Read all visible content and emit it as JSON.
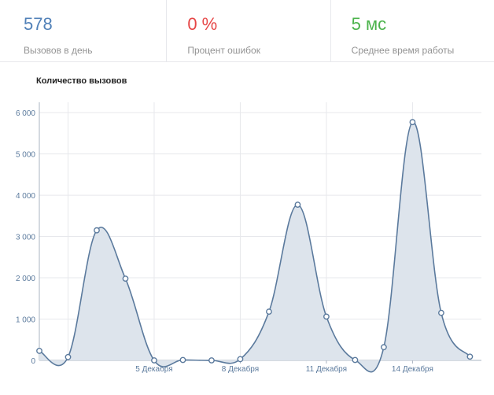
{
  "stats": [
    {
      "value": "578",
      "label": "Вызовов в день",
      "color": "#5181b8"
    },
    {
      "value": "0 %",
      "label": "Процент ошибок",
      "color": "#e64646"
    },
    {
      "value": "5 мс",
      "label": "Среднее время работы",
      "color": "#4bb34b"
    }
  ],
  "chart_data": {
    "type": "area",
    "title": "Количество вызовов",
    "ylim": [
      0,
      6250
    ],
    "yticks": [
      "0",
      "1 000",
      "2 000",
      "3 000",
      "4 000",
      "5 000",
      "6 000"
    ],
    "xticks": [
      "5 Декабря",
      "8 Декабря",
      "11 Декабря",
      "14 Декабря"
    ],
    "x": [
      1,
      2,
      3,
      4,
      5,
      6,
      7,
      8,
      9,
      10,
      11,
      12,
      13,
      14,
      15,
      16
    ],
    "x_ticks_at": [
      5,
      8,
      11,
      14
    ],
    "x_range": [
      1,
      16.4
    ],
    "series": [
      {
        "values": [
          230,
          80,
          3150,
          1980,
          0,
          10,
          0,
          30,
          1180,
          3770,
          1060,
          10,
          320,
          5770,
          1150,
          90
        ]
      }
    ],
    "colors": {
      "line": "#5b7a9d",
      "fill": "#dde4ec",
      "grid": "#e7e8ec",
      "axis": "#aab4c1",
      "tick": "#5b7a9d"
    }
  }
}
